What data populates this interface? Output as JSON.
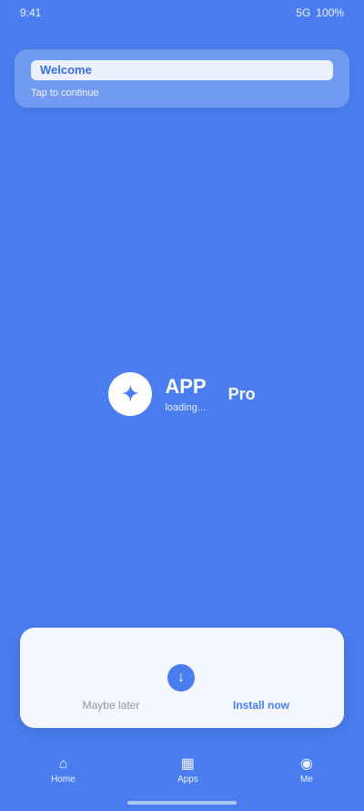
{
  "status_bar": {
    "time": "9:41",
    "network": "5G",
    "battery": "100%"
  },
  "banner": {
    "title": "Welcome",
    "subtitle": "Tap to continue"
  },
  "brand": {
    "logo_glyph": "✦",
    "name": "APP",
    "tagline": "loading...",
    "badge": "Pro"
  },
  "bottom_card": {
    "icon": "download-icon",
    "left_label": "Maybe later",
    "right_label": "Install now"
  },
  "nav": {
    "items": [
      {
        "icon": "home-icon",
        "glyph": "⌂",
        "label": "Home"
      },
      {
        "icon": "apps-icon",
        "glyph": "▦",
        "label": "Apps"
      },
      {
        "icon": "profile-icon",
        "glyph": "◉",
        "label": "Me"
      }
    ]
  },
  "colors": {
    "background": "#4a7ef0",
    "card": "#f4f7fe",
    "accent": "#4a7ef0"
  }
}
